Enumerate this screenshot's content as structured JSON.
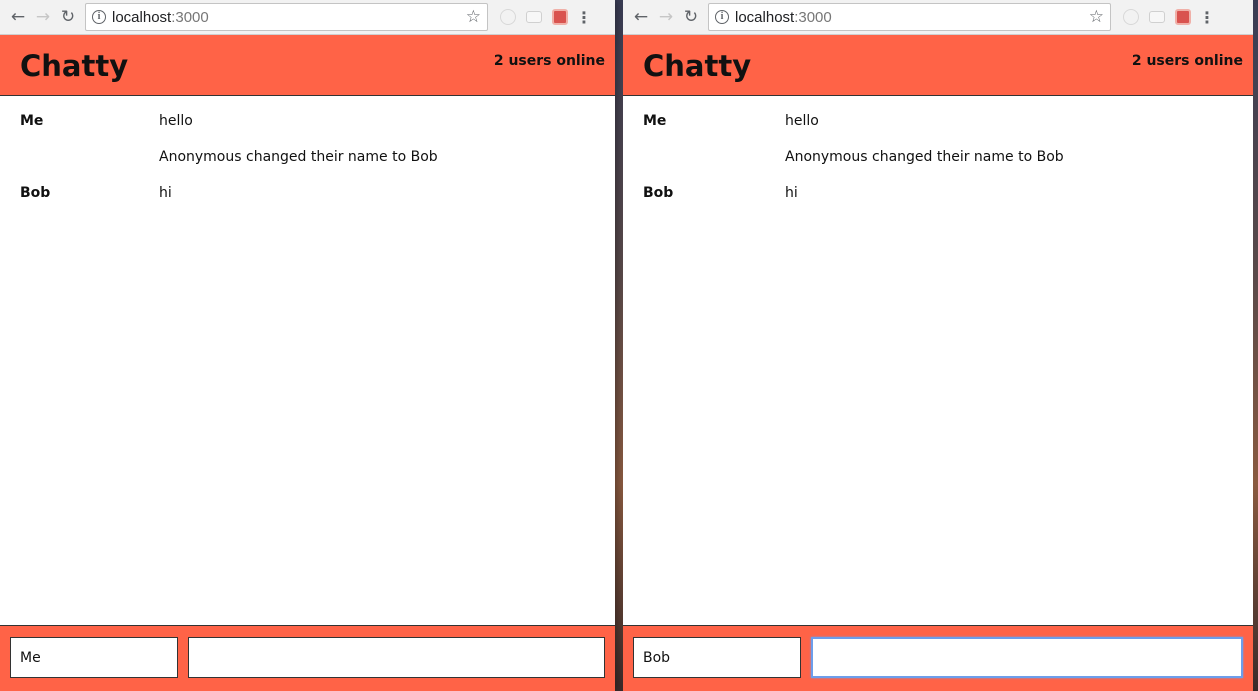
{
  "windows": [
    {
      "browser": {
        "url_host": "localhost",
        "url_port": ":3000"
      },
      "app": {
        "brand": "Chatty",
        "online": "2 users online",
        "messages": [
          {
            "user": "Me",
            "content": "hello"
          },
          {
            "user": "",
            "content": "Anonymous changed their name to Bob"
          },
          {
            "user": "Bob",
            "content": "hi"
          }
        ],
        "chatbar": {
          "username_value": "Me",
          "message_value": ""
        }
      }
    },
    {
      "browser": {
        "url_host": "localhost",
        "url_port": ":3000"
      },
      "app": {
        "brand": "Chatty",
        "online": "2 users online",
        "messages": [
          {
            "user": "Me",
            "content": "hello"
          },
          {
            "user": "",
            "content": "Anonymous changed their name to Bob"
          },
          {
            "user": "Bob",
            "content": "hi"
          }
        ],
        "chatbar": {
          "username_value": "Bob",
          "message_value": ""
        }
      }
    }
  ],
  "colors": {
    "accent": "#ff6347",
    "focus": "#6d9eeb"
  },
  "icons": [
    "back-icon",
    "forward-icon",
    "reload-icon",
    "info-icon",
    "star-icon",
    "extension-icon",
    "menu-icon"
  ]
}
